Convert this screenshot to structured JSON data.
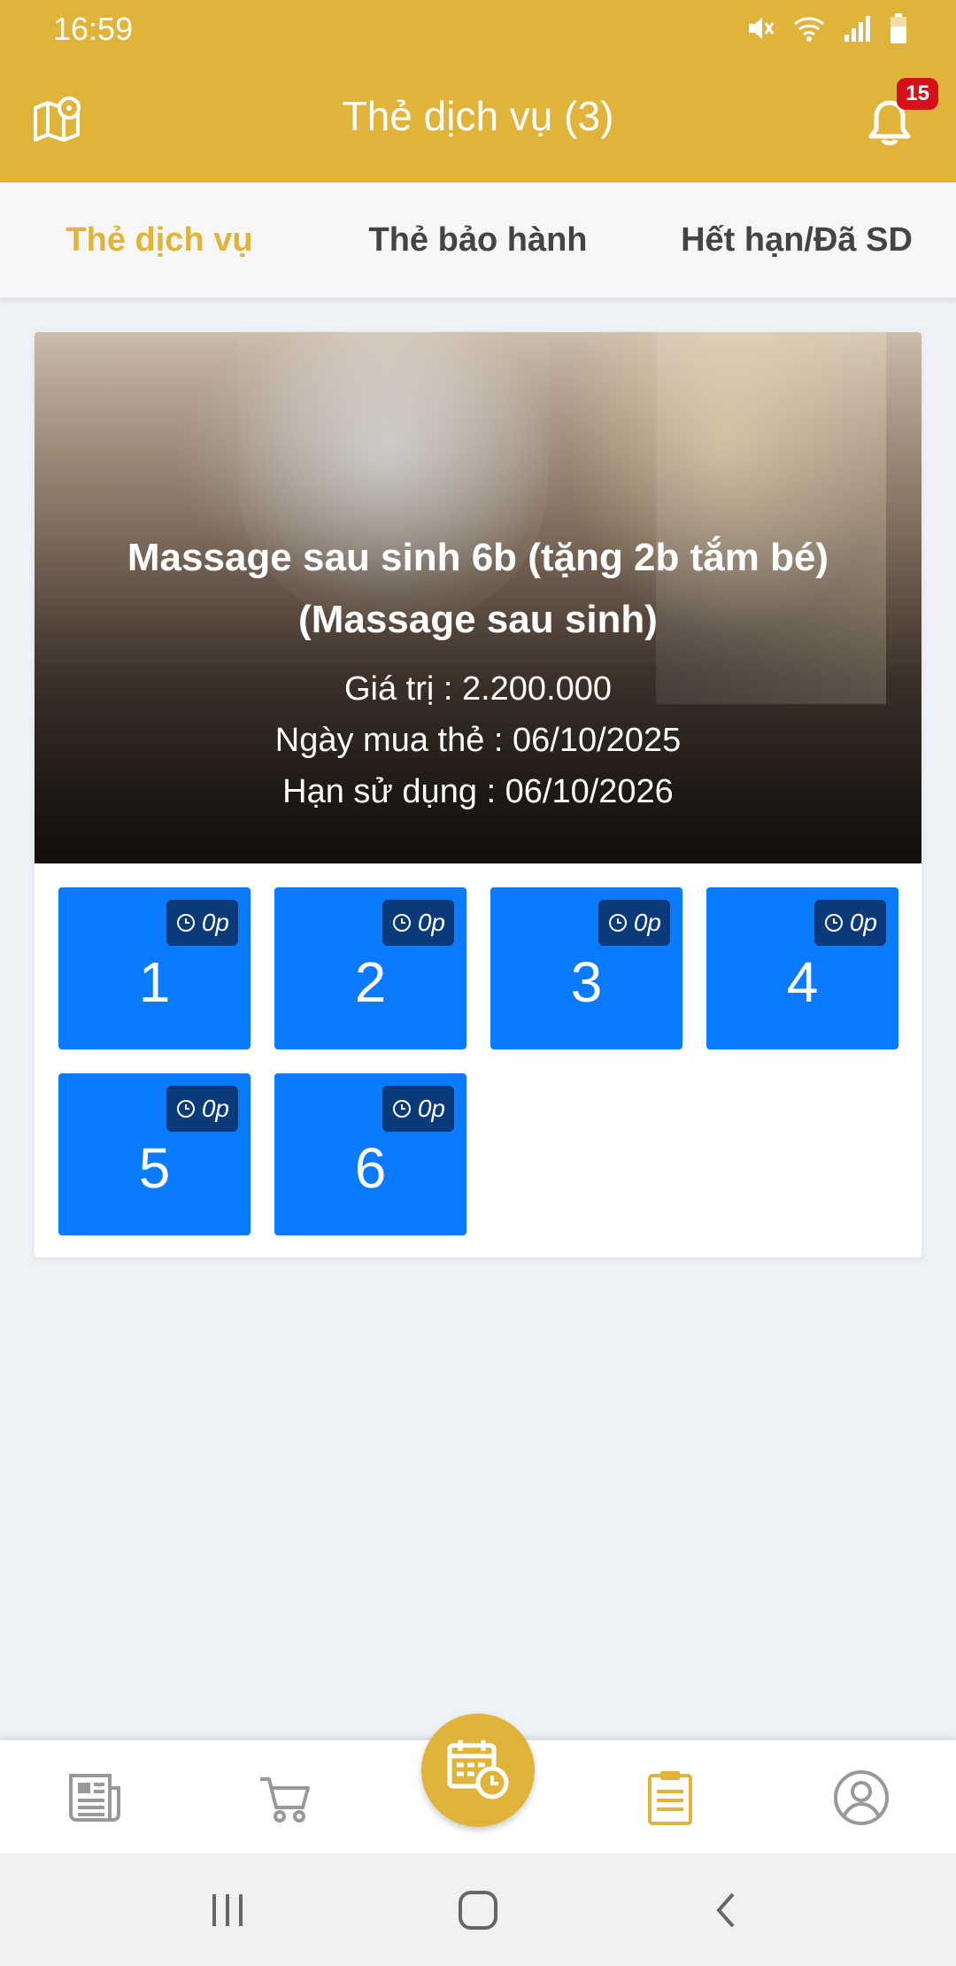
{
  "status": {
    "time": "16:59"
  },
  "header": {
    "title": "Thẻ dịch vụ (3)",
    "badge_count": "15"
  },
  "tabs": [
    {
      "label": "Thẻ dịch vụ",
      "active": true
    },
    {
      "label": "Thẻ bảo hành",
      "active": false
    },
    {
      "label": "Hết hạn/Đã SD",
      "active": false
    }
  ],
  "card": {
    "name": "Massage sau sinh 6b (tặng 2b tắm bé) (Massage sau sinh)",
    "value_line": "Giá trị : 2.200.000",
    "purchase_line": "Ngày mua thẻ : 06/10/2025",
    "expiry_line": "Hạn sử dụng : 06/10/2026",
    "sessions": [
      {
        "number": "1",
        "time": "0p"
      },
      {
        "number": "2",
        "time": "0p"
      },
      {
        "number": "3",
        "time": "0p"
      },
      {
        "number": "4",
        "time": "0p"
      },
      {
        "number": "5",
        "time": "0p"
      },
      {
        "number": "6",
        "time": "0p"
      }
    ]
  },
  "colors": {
    "primary": "#e0b33a",
    "session": "#0a7bff",
    "session_tag": "#0b3a7a",
    "badge": "#d5101a"
  },
  "icons": {
    "statusbar": [
      "mute-icon",
      "wifi-icon",
      "signal-icon",
      "battery-icon"
    ],
    "bottom_nav": [
      "news-icon",
      "cart-icon",
      "booking-calendar-icon",
      "service-card-icon",
      "profile-icon"
    ]
  }
}
